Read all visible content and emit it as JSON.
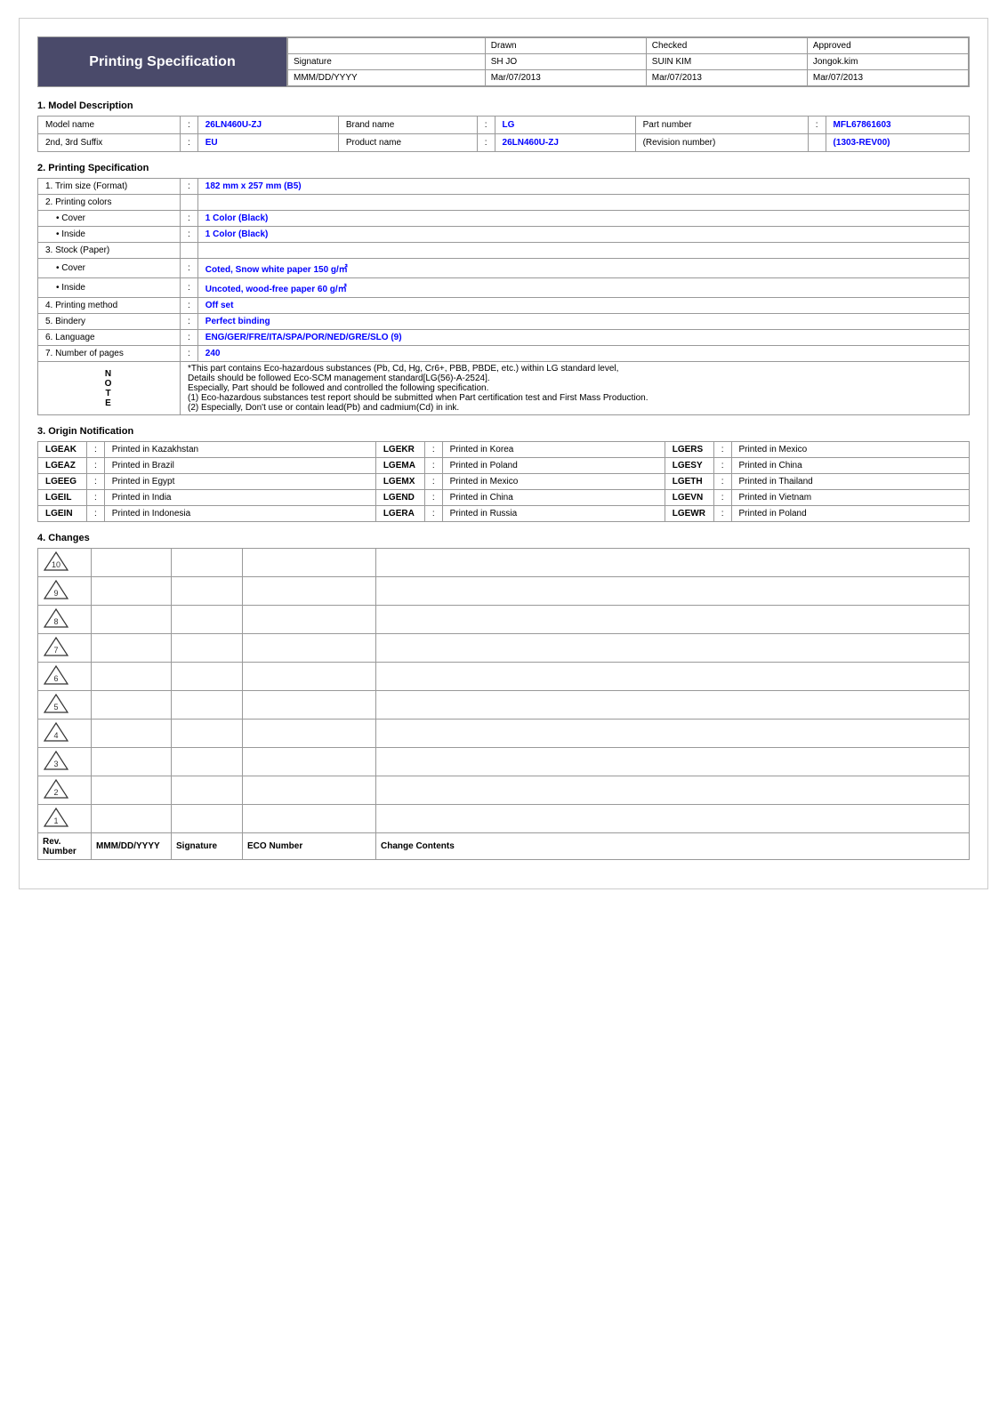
{
  "header": {
    "title": "Printing Specification",
    "columns": [
      "",
      "Drawn",
      "Checked",
      "Approved"
    ],
    "rows": [
      {
        "label": "Signature",
        "drawn": "SH JO",
        "checked": "SUIN KIM",
        "approved": "Jongok.kim"
      },
      {
        "label": "MMM/DD/YYYY",
        "drawn": "Mar/07/2013",
        "checked": "Mar/07/2013",
        "approved": "Mar/07/2013"
      }
    ]
  },
  "section1": {
    "title": "1. Model Description",
    "rows": [
      [
        {
          "label": "Model name",
          "colon": ":",
          "value": "26LN460U-ZJ",
          "valueClass": "blue"
        },
        {
          "label": "Brand name",
          "colon": ":",
          "value": "LG",
          "valueClass": "blue"
        },
        {
          "label": "Part number",
          "colon": ":",
          "value": "MFL67861603",
          "valueClass": "blue"
        }
      ],
      [
        {
          "label": "2nd, 3rd Suffix",
          "colon": ":",
          "value": "EU",
          "valueClass": "blue"
        },
        {
          "label": "Product name",
          "colon": ":",
          "value": "26LN460U-ZJ",
          "valueClass": "blue"
        },
        {
          "label": "(Revision number)",
          "colon": "",
          "value": "(1303-REV00)",
          "valueClass": "blue"
        }
      ]
    ]
  },
  "section2": {
    "title": "2. Printing Specification",
    "items": [
      {
        "indent": 0,
        "label": "1. Trim size (Format)",
        "colon": ":",
        "value": "182 mm x 257 mm (B5)",
        "valueClass": "blue"
      },
      {
        "indent": 0,
        "label": "2. Printing colors",
        "colon": "",
        "value": "",
        "valueClass": ""
      },
      {
        "indent": 1,
        "label": "• Cover",
        "colon": ":",
        "value": "1 Color (Black)",
        "valueClass": "blue"
      },
      {
        "indent": 1,
        "label": "• Inside",
        "colon": ":",
        "value": "1 Color (Black)",
        "valueClass": "blue"
      },
      {
        "indent": 0,
        "label": "3. Stock (Paper)",
        "colon": "",
        "value": "",
        "valueClass": ""
      },
      {
        "indent": 1,
        "label": "• Cover",
        "colon": ":",
        "value": "Coted, Snow white paper 150 g/㎡",
        "valueClass": "blue"
      },
      {
        "indent": 1,
        "label": "• Inside",
        "colon": ":",
        "value": "Uncoted, wood-free paper 60 g/㎡",
        "valueClass": "blue"
      },
      {
        "indent": 0,
        "label": "4. Printing method",
        "colon": ":",
        "value": "Off set",
        "valueClass": "blue"
      },
      {
        "indent": 0,
        "label": "5. Bindery",
        "colon": ":",
        "value": "Perfect binding",
        "valueClass": "blue"
      },
      {
        "indent": 0,
        "label": "6. Language",
        "colon": ":",
        "value": "ENG/GER/FRE/ITA/SPA/POR/NED/GRE/SLO (9)",
        "valueClass": "blue"
      },
      {
        "indent": 0,
        "label": "7. Number of pages",
        "colon": ":",
        "value": "240",
        "valueClass": "blue"
      }
    ],
    "notes": [
      {
        "side": "",
        "text": "*This part contains Eco-hazardous substances (Pb, Cd, Hg, Cr6+, PBB, PBDE, etc.) within LG standard level,"
      },
      {
        "side": "N",
        "text": "Details should be followed Eco-SCM management standard[LG(56)-A-2524]."
      },
      {
        "side": "O",
        "text": ""
      },
      {
        "side": "T",
        "text": "Especially, Part should be followed and controlled the following specification."
      },
      {
        "side": "E",
        "text": "(1) Eco-hazardous substances test report should be submitted when Part certification test and First Mass Production."
      },
      {
        "side": "",
        "text": "(2) Especially, Don't use or contain lead(Pb) and cadmium(Cd) in ink."
      }
    ]
  },
  "section3": {
    "title": "3. Origin Notification",
    "rows": [
      [
        {
          "code": "LGEAK",
          "colon": ":",
          "desc": "Printed in Kazakhstan"
        },
        {
          "code": "LGEKR",
          "colon": ":",
          "desc": "Printed in Korea"
        },
        {
          "code": "LGERS",
          "colon": ":",
          "desc": "Printed in Mexico"
        }
      ],
      [
        {
          "code": "LGEAZ",
          "colon": ":",
          "desc": "Printed in Brazil"
        },
        {
          "code": "LGEMA",
          "colon": ":",
          "desc": "Printed in Poland"
        },
        {
          "code": "LGESY",
          "colon": ":",
          "desc": "Printed in China"
        }
      ],
      [
        {
          "code": "LGEEG",
          "colon": ":",
          "desc": "Printed in Egypt"
        },
        {
          "code": "LGEMX",
          "colon": ":",
          "desc": "Printed in Mexico"
        },
        {
          "code": "LGETH",
          "colon": ":",
          "desc": "Printed in Thailand"
        }
      ],
      [
        {
          "code": "LGEIL",
          "colon": ":",
          "desc": "Printed in India"
        },
        {
          "code": "LGEND",
          "colon": ":",
          "desc": "Printed in China"
        },
        {
          "code": "LGEVN",
          "colon": ":",
          "desc": "Printed in Vietnam"
        }
      ],
      [
        {
          "code": "LGEIN",
          "colon": ":",
          "desc": "Printed in Indonesia"
        },
        {
          "code": "LGERA",
          "colon": ":",
          "desc": "Printed in Russia"
        },
        {
          "code": "LGEWR",
          "colon": ":",
          "desc": "Printed in Poland"
        }
      ]
    ]
  },
  "section4": {
    "title": "4. Changes",
    "rev_numbers": [
      "10",
      "9",
      "8",
      "7",
      "6",
      "5",
      "4",
      "3",
      "2",
      "1"
    ],
    "footer": {
      "col1": "Rev. Number",
      "col2": "MMM/DD/YYYY",
      "col3": "Signature",
      "col4": "ECO Number",
      "col5": "Change Contents"
    }
  }
}
